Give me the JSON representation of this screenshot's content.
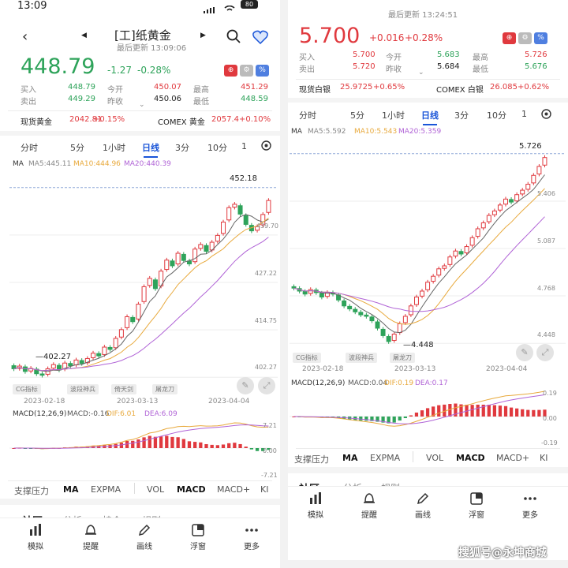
{
  "left": {
    "status_time": "13:09",
    "battery": "80",
    "title": "[工]纸黄金",
    "subtitle": "最后更新 13:09:06",
    "price": "448.79",
    "change": "-1.27",
    "change_pct": "-0.28%",
    "quote": {
      "buy_label": "买入",
      "buy": "448.79",
      "sell_label": "卖出",
      "sell": "449.29",
      "open_label": "今开",
      "open": "450.07",
      "prev_label": "昨收",
      "prev": "450.06",
      "high_label": "最高",
      "high": "451.29",
      "low_label": "最低",
      "low": "448.59"
    },
    "related": [
      {
        "name": "现货黄金",
        "value": "2042.81",
        "pct": "+0.15%"
      },
      {
        "name": "COMEX 黄金",
        "value": "2057.4",
        "pct": "+0.10%"
      }
    ],
    "period_tabs": [
      "分时",
      "5分",
      "1小时",
      "日线",
      "3分",
      "10分",
      "1"
    ],
    "active_tab": "日线",
    "ma_legend": {
      "label": "MA",
      "ma5": "MA5:445.11",
      "ma10": "MA10:444.96",
      "ma20": "MA20:440.39"
    },
    "price_labels": [
      "452.18",
      "439.70",
      "427.22",
      "414.75",
      "402.27"
    ],
    "high_marker": "452.18",
    "low_marker": "402.27",
    "dates": [
      "2023-02-18",
      "2023-03-13",
      "2023-04-04"
    ],
    "tools": [
      "CG指标",
      "波段神兵",
      "倚天剑",
      "屠龙刀"
    ],
    "macd_legend": {
      "label": "MACD(12,26,9)",
      "macd": "MACD:-0.16",
      "dif": "DIF:6.01",
      "dea": "DEA:6.09"
    },
    "macd_labels": [
      "7.21",
      "0.00",
      "-7.21"
    ],
    "indicators": [
      "支撑压力",
      "MA",
      "EXPMA",
      "VOL",
      "MACD",
      "MACD+",
      "KI"
    ],
    "partial_tabs": [
      "社区",
      "分析",
      "持仓",
      "规则"
    ],
    "bottom": [
      "模拟",
      "提醒",
      "画线",
      "浮窗",
      "更多"
    ]
  },
  "right": {
    "subtitle": "最后更新 13:24:51",
    "price": "5.700",
    "change": "+0.016",
    "change_pct": "+0.28%",
    "quote": {
      "buy_label": "买入",
      "buy": "5.700",
      "sell_label": "卖出",
      "sell": "5.720",
      "open_label": "今开",
      "open": "5.683",
      "prev_label": "昨收",
      "prev": "5.684",
      "high_label": "最高",
      "high": "5.726",
      "low_label": "最低",
      "low": "5.676"
    },
    "related": [
      {
        "name": "现货白银",
        "value": "25.9725",
        "pct": "+0.65%"
      },
      {
        "name": "COMEX 白银",
        "value": "26.085",
        "pct": "+0.62%"
      }
    ],
    "period_tabs": [
      "分时",
      "5分",
      "1小时",
      "日线",
      "3分",
      "10分",
      "1"
    ],
    "active_tab": "日线",
    "ma_legend": {
      "label": "MA",
      "ma5": "MA5:5.592",
      "ma10": "MA10:5.543",
      "ma20": "MA20:5.359"
    },
    "price_labels": [
      "5.726",
      "5.406",
      "5.087",
      "4.768",
      "4.448"
    ],
    "high_marker": "5.726",
    "low_marker": "4.448",
    "dates": [
      "2023-02-18",
      "2023-03-13",
      "2023-04-04"
    ],
    "tools": [
      "CG指标",
      "波段神兵",
      "屠龙刀"
    ],
    "macd_legend": {
      "label": "MACD(12,26,9)",
      "macd": "MACD:0.04",
      "dif": "DIF:0.19",
      "dea": "DEA:0.17"
    },
    "macd_labels": [
      "0.19",
      "0.00",
      "-0.19"
    ],
    "indicators": [
      "支撑压力",
      "MA",
      "EXPMA",
      "VOL",
      "MACD",
      "MACD+",
      "KI"
    ],
    "partial_tabs": [
      "社区",
      "分析",
      "规则"
    ],
    "bottom": [
      "模拟",
      "提醒",
      "画线",
      "浮窗",
      "更多"
    ]
  },
  "watermark": "搜狐号@永坤商城",
  "colors": {
    "up": "#e0393e",
    "down": "#2ea35a",
    "accent": "#1a55d8",
    "ma5": "#666666",
    "ma10": "#e8a93c",
    "ma20": "#b063d6"
  },
  "chart_data": [
    {
      "type": "candlestick",
      "name": "[工]纸黄金 日线",
      "x_range": [
        "2023-02-18",
        "2023-04-04"
      ],
      "ylim": [
        402.27,
        452.18
      ],
      "y_ticks": [
        452.18,
        439.7,
        427.22,
        414.75,
        402.27
      ],
      "closes": [
        404.5,
        405.2,
        403.8,
        404.6,
        403.2,
        402.8,
        404.5,
        405.6,
        404.2,
        406.0,
        405.3,
        406.8,
        405.9,
        407.2,
        408.6,
        407.9,
        410.2,
        409.6,
        412.5,
        414.8,
        418.2,
        416.9,
        421.5,
        426.1,
        428.3,
        425.6,
        430.2,
        433.1,
        431.6,
        434.9,
        433.0,
        432.1,
        436.0,
        437.2,
        435.4,
        437.8,
        439.6,
        443.1,
        446.9,
        447.8,
        445.2,
        442.5,
        440.8,
        441.9,
        445.1,
        448.79
      ],
      "macd": {
        "dif": 6.01,
        "dea": 6.09,
        "macd": -0.16,
        "range": [
          -7.21,
          7.21
        ]
      }
    },
    {
      "type": "candlestick",
      "name": "白银 日线",
      "x_range": [
        "2023-02-18",
        "2023-04-04"
      ],
      "ylim": [
        4.448,
        5.726
      ],
      "y_ticks": [
        5.726,
        5.406,
        5.087,
        4.768,
        4.448
      ],
      "closes": [
        4.82,
        4.8,
        4.78,
        4.81,
        4.79,
        4.76,
        4.79,
        4.78,
        4.74,
        4.7,
        4.68,
        4.66,
        4.64,
        4.63,
        4.6,
        4.55,
        4.5,
        4.46,
        4.51,
        4.58,
        4.63,
        4.7,
        4.76,
        4.8,
        4.86,
        4.9,
        4.95,
        4.97,
        5.03,
        5.07,
        5.05,
        5.1,
        5.16,
        5.22,
        5.26,
        5.31,
        5.34,
        5.38,
        5.42,
        5.4,
        5.45,
        5.48,
        5.52,
        5.58,
        5.64,
        5.7
      ],
      "macd": {
        "dif": 0.19,
        "dea": 0.17,
        "macd": 0.04,
        "range": [
          -0.19,
          0.19
        ]
      }
    }
  ]
}
